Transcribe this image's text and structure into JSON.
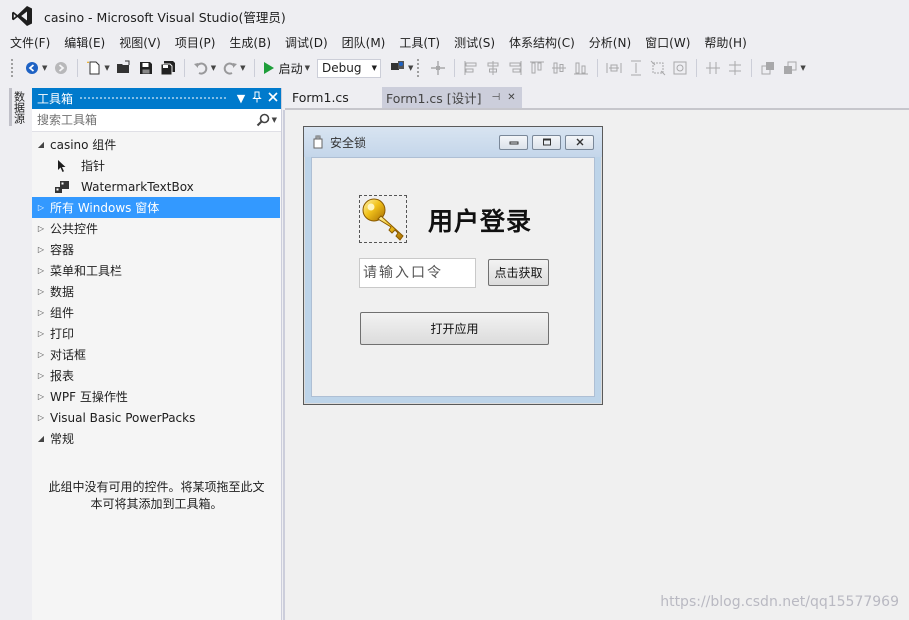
{
  "window": {
    "title": "casino - Microsoft Visual Studio(管理员)"
  },
  "menu": [
    "文件(F)",
    "编辑(E)",
    "视图(V)",
    "项目(P)",
    "生成(B)",
    "调试(D)",
    "团队(M)",
    "工具(T)",
    "测试(S)",
    "体系结构(C)",
    "分析(N)",
    "窗口(W)",
    "帮助(H)"
  ],
  "toolbar": {
    "start_label": "启动",
    "config_value": "Debug"
  },
  "side_strip": {
    "tab_label": "数据源"
  },
  "toolbox": {
    "title": "工具箱",
    "search_placeholder": "搜索工具箱",
    "group_casino": "casino 组件",
    "items": [
      "指针",
      "WatermarkTextBox"
    ],
    "groups": [
      "所有 Windows 窗体",
      "公共控件",
      "容器",
      "菜单和工具栏",
      "数据",
      "组件",
      "打印",
      "对话框",
      "报表",
      "WPF 互操作性",
      "Visual Basic PowerPacks"
    ],
    "group_general": "常规",
    "empty_message": "此组中没有可用的控件。将某项拖至此文本可将其添加到工具箱。"
  },
  "tabs": {
    "code": "Form1.cs",
    "design": "Form1.cs [设计]"
  },
  "form": {
    "caption": "安全锁",
    "heading": "用户登录",
    "password_placeholder": "请输入口令",
    "get_button": "点击获取",
    "open_button": "打开应用"
  },
  "watermark": "https://blog.csdn.net/qq15577969",
  "colors": {
    "accent": "#007acc",
    "selection": "#3399ff",
    "start_green": "#1e9e3a"
  }
}
